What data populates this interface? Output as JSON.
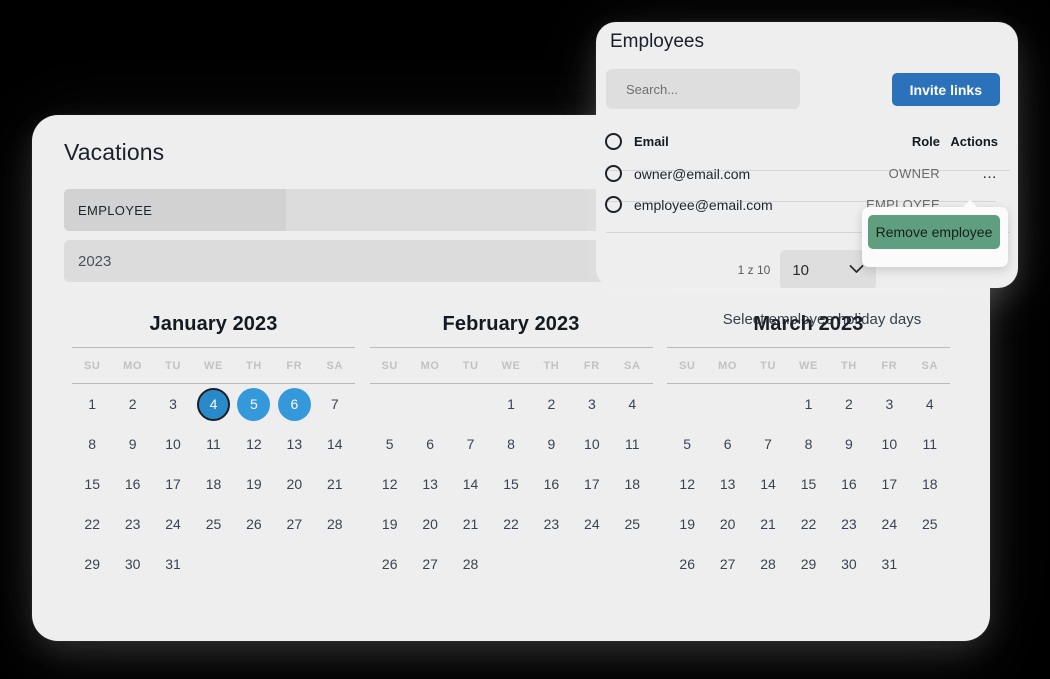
{
  "vacations": {
    "title": "Vacations",
    "employee_field": {
      "value": "EMPLOYEE"
    },
    "year_field": {
      "value": "2023"
    },
    "holiday_hint": "Select employee holiday days",
    "dow": [
      "SU",
      "MO",
      "TU",
      "WE",
      "TH",
      "FR",
      "SA"
    ],
    "months": [
      {
        "caption": "January 2023",
        "lead_blanks": 0,
        "days": 31,
        "selected": [
          5,
          6
        ],
        "focused": [
          4
        ]
      },
      {
        "caption": "February 2023",
        "lead_blanks": 3,
        "days": 28,
        "selected": [],
        "focused": []
      },
      {
        "caption": "March 2023",
        "lead_blanks": 3,
        "days": 31,
        "selected": [],
        "focused": []
      }
    ]
  },
  "employees": {
    "title": "Employees",
    "search": {
      "placeholder": "Search...",
      "value": ""
    },
    "invite_label": "Invite links",
    "columns": {
      "email": "Email",
      "role": "Role",
      "actions": "Actions"
    },
    "rows": [
      {
        "email": "owner@email.com",
        "role": "OWNER",
        "actions_icon": "…"
      },
      {
        "email": "employee@email.com",
        "role": "EMPLOYEE",
        "actions_icon": "…"
      }
    ],
    "pagination": {
      "label": "1 z 10",
      "page_size": "10",
      "chevron": "chevron-down"
    },
    "action_menu": {
      "remove_label": "Remove employee"
    }
  },
  "colors": {
    "background": "#000000",
    "card": "#eeeeee",
    "field": "#dcdcdc",
    "accent_blue": "#3498db",
    "invite_blue": "#2b72bb",
    "remove_green": "#5f9e7e",
    "text": "#1d242e",
    "muted": "#6a6a6a"
  }
}
